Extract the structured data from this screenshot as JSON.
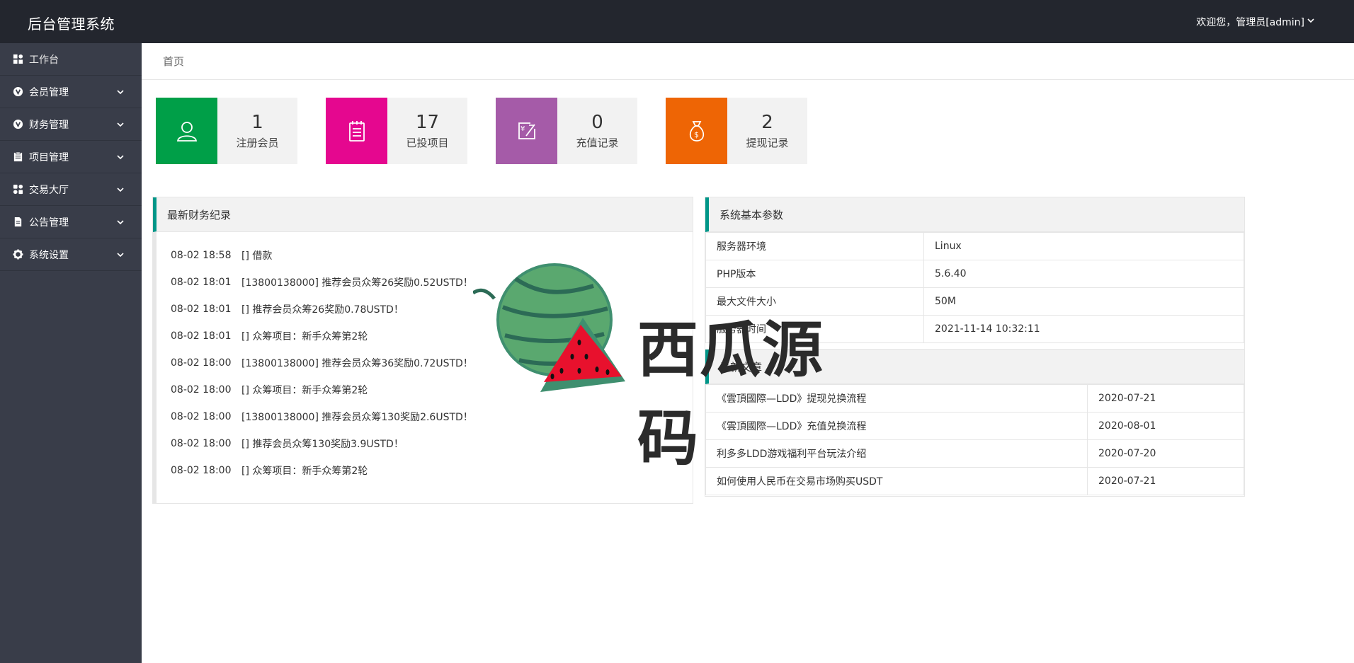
{
  "header": {
    "app_title": "后台管理系统",
    "user_greeting": "欢迎您，管理员[admin]"
  },
  "sidebar": {
    "items": [
      {
        "label": "工作台",
        "icon": "dashboard-icon"
      },
      {
        "label": "会员管理",
        "icon": "v-circle-icon"
      },
      {
        "label": "财务管理",
        "icon": "v-circle-icon"
      },
      {
        "label": "项目管理",
        "icon": "clipboard-icon"
      },
      {
        "label": "交易大厅",
        "icon": "apps-icon"
      },
      {
        "label": "公告管理",
        "icon": "document-icon"
      },
      {
        "label": "系统设置",
        "icon": "gear-icon"
      }
    ]
  },
  "breadcrumb": "首页",
  "stats": [
    {
      "value": "1",
      "label": "注册会员",
      "color": "#009f48",
      "icon": "user-icon"
    },
    {
      "value": "17",
      "label": "已投项目",
      "color": "#e5078f",
      "icon": "notepad-icon"
    },
    {
      "value": "0",
      "label": "充值记录",
      "color": "#a55ba8",
      "icon": "recharge-icon"
    },
    {
      "value": "2",
      "label": "提现记录",
      "color": "#ee6505",
      "icon": "money-bag-icon"
    }
  ],
  "finance": {
    "title": "最新财务纪录",
    "records": [
      {
        "time": "08-02 18:58",
        "text": "[] 借款"
      },
      {
        "time": "08-02 18:01",
        "text": "[13800138000] 推荐会员众筹26奖励0.52USTD！"
      },
      {
        "time": "08-02 18:01",
        "text": "[] 推荐会员众筹26奖励0.78USTD！"
      },
      {
        "time": "08-02 18:01",
        "text": "[] 众筹项目：新手众筹第2轮"
      },
      {
        "time": "08-02 18:00",
        "text": "[13800138000] 推荐会员众筹36奖励0.72USTD！"
      },
      {
        "time": "08-02 18:00",
        "text": "[] 众筹项目：新手众筹第2轮"
      },
      {
        "time": "08-02 18:00",
        "text": "[13800138000] 推荐会员众筹130奖励2.6USTD！"
      },
      {
        "time": "08-02 18:00",
        "text": "[] 推荐会员众筹130奖励3.9USTD！"
      },
      {
        "time": "08-02 18:00",
        "text": "[] 众筹项目：新手众筹第2轮"
      }
    ]
  },
  "system": {
    "title": "系统基本参数",
    "rows": [
      {
        "key": "服务器环境",
        "value": "Linux"
      },
      {
        "key": "PHP版本",
        "value": "5.6.40"
      },
      {
        "key": "最大文件大小",
        "value": "50M"
      },
      {
        "key": "服务器时间",
        "value": "2021-11-14 10:32:11"
      }
    ]
  },
  "articles": {
    "title": "最新文章",
    "rows": [
      {
        "title": "《雲頂國際—LDD》提现兑换流程",
        "date": "2020-07-21"
      },
      {
        "title": "《雲頂國際—LDD》充值兑换流程",
        "date": "2020-08-01"
      },
      {
        "title": "利多多LDD游戏福利平台玩法介绍",
        "date": "2020-07-20"
      },
      {
        "title": "如何使用人民币在交易市场购买USDT",
        "date": "2020-07-21"
      }
    ]
  },
  "watermark": {
    "text": "西瓜源码"
  }
}
